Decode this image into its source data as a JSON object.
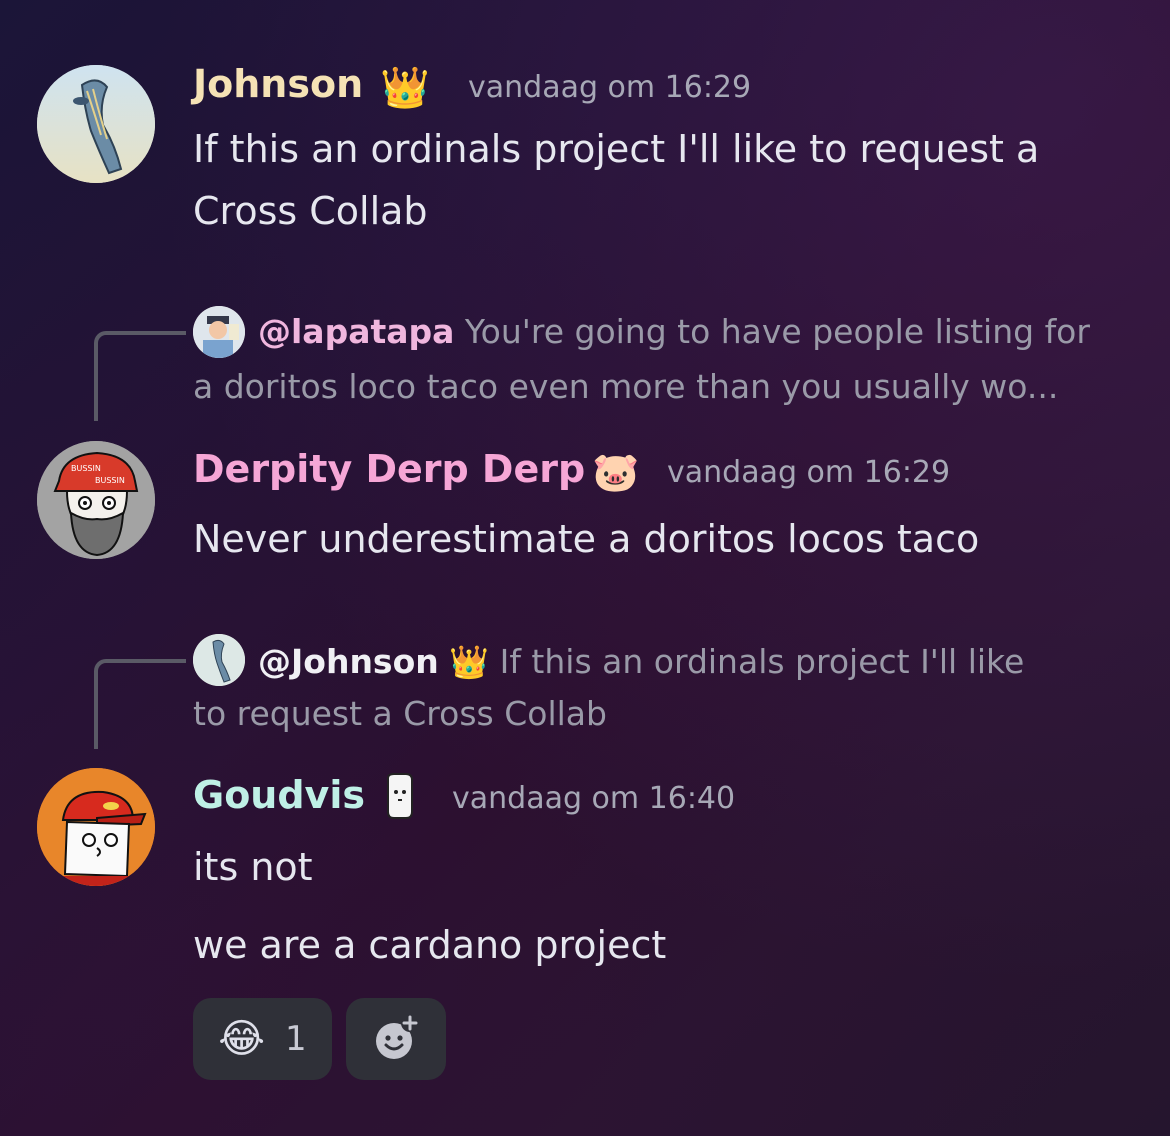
{
  "messages": [
    {
      "author": "Johnson",
      "author_color": "#f5e2b5",
      "badge_icon": "crown-icon",
      "timestamp": "vandaag om 16:29",
      "lines": [
        "If this an ordinals project I'll like to request a",
        "Cross Collab"
      ]
    },
    {
      "reply_to": {
        "mention": "@lapatapa",
        "preview_lines": [
          "You're going to have people listing for",
          "a doritos loco taco even more than you usually wo..."
        ]
      },
      "author": "Derpity Derp Derp",
      "author_color": "#f6a6d6",
      "badge_icon": "pig-icon",
      "timestamp": "vandaag om 16:29",
      "lines": [
        "Never underestimate a doritos locos taco"
      ]
    },
    {
      "reply_to": {
        "mention": "@Johnson",
        "preview_lines": [
          "If this an ordinals project I'll like",
          "to request a Cross Collab"
        ]
      },
      "author": "Goudvis",
      "author_color": "#bff0e6",
      "badge_icon": "ghost-icon",
      "timestamp": "vandaag om 16:40",
      "lines": [
        "its not",
        "we are a cardano project"
      ],
      "reactions": [
        {
          "emoji": "😂",
          "icon": "tears-of-joy-icon",
          "count": "1"
        },
        {
          "icon": "add-reaction-icon"
        }
      ]
    }
  ]
}
